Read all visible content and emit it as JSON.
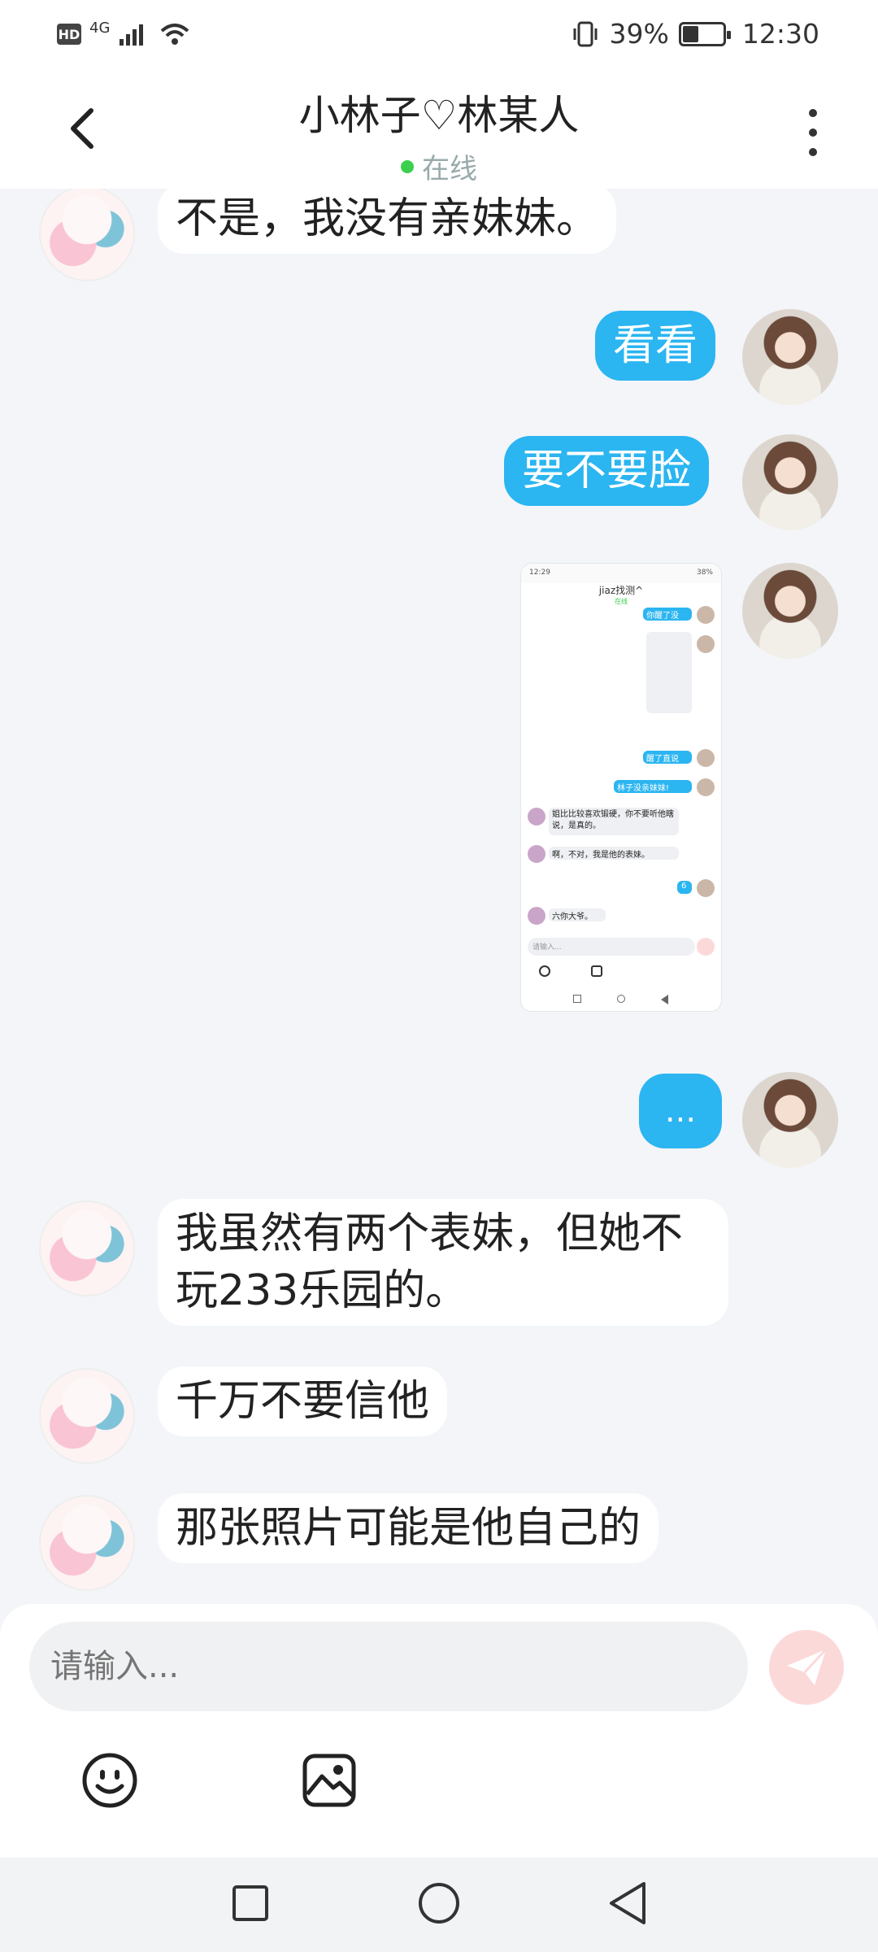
{
  "status_bar": {
    "hd": "HD",
    "network": "4G",
    "battery_percent": "39%",
    "battery_level": 0.39,
    "time": "12:30"
  },
  "header": {
    "title": "小林子♡林某人",
    "status": "在线"
  },
  "messages": [
    {
      "side": "left",
      "type": "text",
      "text": "不是，我没有亲妹妹。"
    },
    {
      "side": "right",
      "type": "text",
      "text": "看看"
    },
    {
      "side": "right",
      "type": "text",
      "text": "要不要脸"
    },
    {
      "side": "right",
      "type": "image",
      "image": {
        "status_time": "12:29",
        "status_battery": "38%",
        "title": "jiaz找测^",
        "subtitle": "在线",
        "lines": [
          "你醒了没",
          "醒了直说",
          "林子没亲妹妹!",
          "姐比比较喜欢锻硬，你不要听他瞎说，是真的。",
          "啊，不对，我是他的表妹。",
          "6",
          "六你大爷。"
        ],
        "input_placeholder": "请输入..."
      }
    },
    {
      "side": "right",
      "type": "text",
      "text": "..."
    },
    {
      "side": "left",
      "type": "text",
      "text_line1": "我虽然有两个表妹，但她不",
      "text_line2": "玩233乐园的。"
    },
    {
      "side": "left",
      "type": "text",
      "text": "千万不要信他"
    },
    {
      "side": "left",
      "type": "text",
      "text": "那张照片可能是他自己的"
    }
  ],
  "input": {
    "placeholder": "请输入..."
  },
  "icons": {
    "back": "back-arrow-icon",
    "more": "more-vertical-icon",
    "send": "send-icon",
    "emoji": "emoji-icon",
    "image": "image-icon",
    "nav_recent": "square-icon",
    "nav_home": "circle-icon",
    "nav_back": "triangle-back-icon"
  },
  "colors": {
    "accent": "#2bb5f1",
    "online": "#3ccf4e",
    "send_disabled": "#fcd9d9"
  }
}
